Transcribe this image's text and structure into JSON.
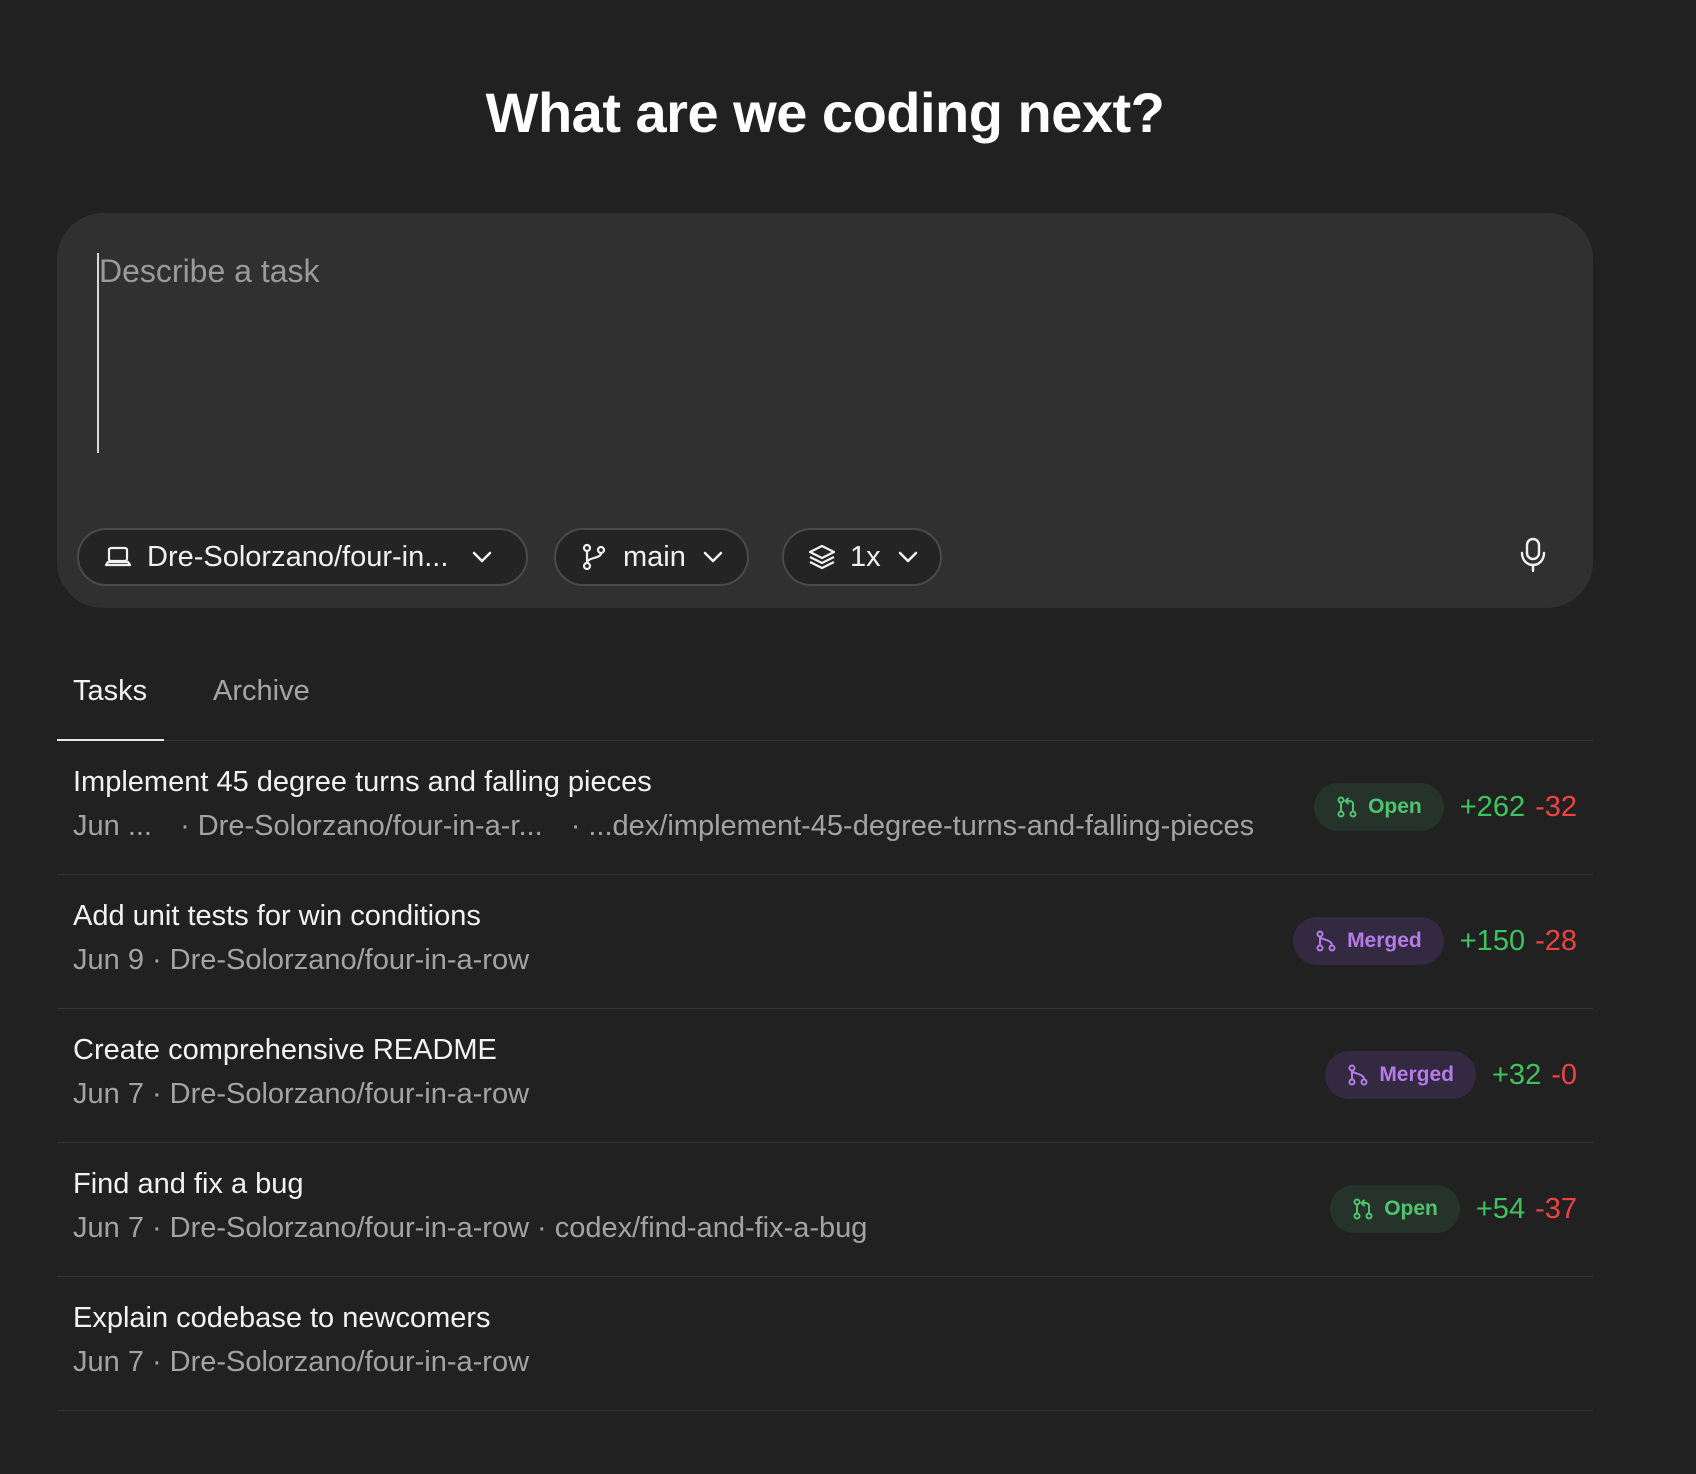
{
  "header": {
    "title": "What are we coding next?"
  },
  "composer": {
    "placeholder": "Describe a task",
    "repo_label": "Dre-Solorzano/four-in...",
    "branch_label": "main",
    "versions_label": "1x"
  },
  "tabs": [
    {
      "label": "Tasks",
      "active": true
    },
    {
      "label": "Archive",
      "active": false
    }
  ],
  "tasks": [
    {
      "title": "Implement 45 degree turns and falling pieces",
      "date": "Jun ...",
      "repo": "Dre-Solorzano/four-in-a-r...",
      "branch": "...dex/implement-45-degree-turns-and-falling-pieces",
      "status": "Open",
      "additions": "+262",
      "deletions": "-32"
    },
    {
      "title": "Add unit tests for win conditions",
      "date": "Jun 9",
      "repo": "Dre-Solorzano/four-in-a-row",
      "status": "Merged",
      "additions": "+150",
      "deletions": "-28"
    },
    {
      "title": "Create comprehensive README",
      "date": "Jun 7",
      "repo": "Dre-Solorzano/four-in-a-row",
      "status": "Merged",
      "additions": "+32",
      "deletions": "-0"
    },
    {
      "title": "Find and fix a bug",
      "date": "Jun 7",
      "repo": "Dre-Solorzano/four-in-a-row",
      "branch": "codex/find-and-fix-a-bug",
      "status": "Open",
      "additions": "+54",
      "deletions": "-37"
    },
    {
      "title": "Explain codebase to newcomers",
      "date": "Jun 7",
      "repo": "Dre-Solorzano/four-in-a-row"
    }
  ],
  "colors": {
    "background": "#212121",
    "composer": "#303030",
    "open_badge_text": "#4ec46e",
    "merged_badge_text": "#b57be8",
    "additions": "#3ec45f",
    "deletions": "#ef4343"
  },
  "icons": {
    "repo": "laptop-icon",
    "branch": "git-branch-icon",
    "versions": "layers-icon",
    "chevron": "chevron-down-icon",
    "mic": "microphone-icon",
    "open": "pull-request-icon",
    "merged": "merge-icon"
  }
}
